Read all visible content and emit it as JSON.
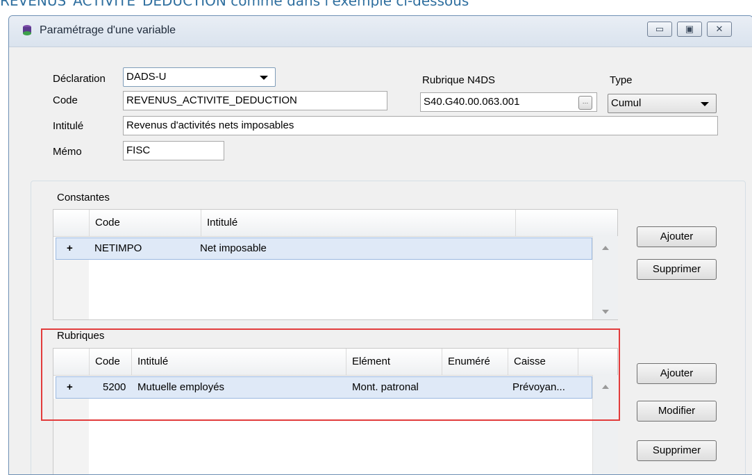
{
  "top_text": "REVENUS_ACTIVITE_DEDUCTION comme dans l'exemple ci-dessous",
  "window": {
    "title": "Paramétrage d'une variable"
  },
  "form": {
    "declaration_label": "Déclaration",
    "declaration_value": "DADS-U",
    "code_label": "Code",
    "code_value": "REVENUS_ACTIVITE_DEDUCTION",
    "intitule_label": "Intitulé",
    "intitule_value": "Revenus d'activités nets imposables",
    "memo_label": "Mémo",
    "memo_value": "FISC",
    "rubrique_label": "Rubrique N4DS",
    "rubrique_value": "S40.G40.00.063.001",
    "type_label": "Type",
    "type_value": "Cumul"
  },
  "constantes": {
    "title": "Constantes",
    "headers": [
      "Code",
      "Intitulé"
    ],
    "rows": [
      {
        "expand": "+",
        "code": "NETIMPO",
        "intitule": "Net imposable"
      }
    ],
    "buttons": {
      "add": "Ajouter",
      "delete": "Supprimer"
    }
  },
  "rubriques": {
    "title": "Rubriques",
    "headers": [
      "Code",
      "Intitulé",
      "Elément",
      "Enuméré",
      "Caisse"
    ],
    "rows": [
      {
        "expand": "+",
        "code": "5200",
        "intitule": "Mutuelle employés",
        "element": "Mont. patronal",
        "enumere": "",
        "caisse": "Prévoyan..."
      }
    ],
    "buttons": {
      "add": "Ajouter",
      "modify": "Modifier",
      "delete": "Supprimer"
    }
  },
  "colors": {
    "highlight": "#e23b3b",
    "selection": "#dfe9f7",
    "accent": "#2f6f9f"
  }
}
